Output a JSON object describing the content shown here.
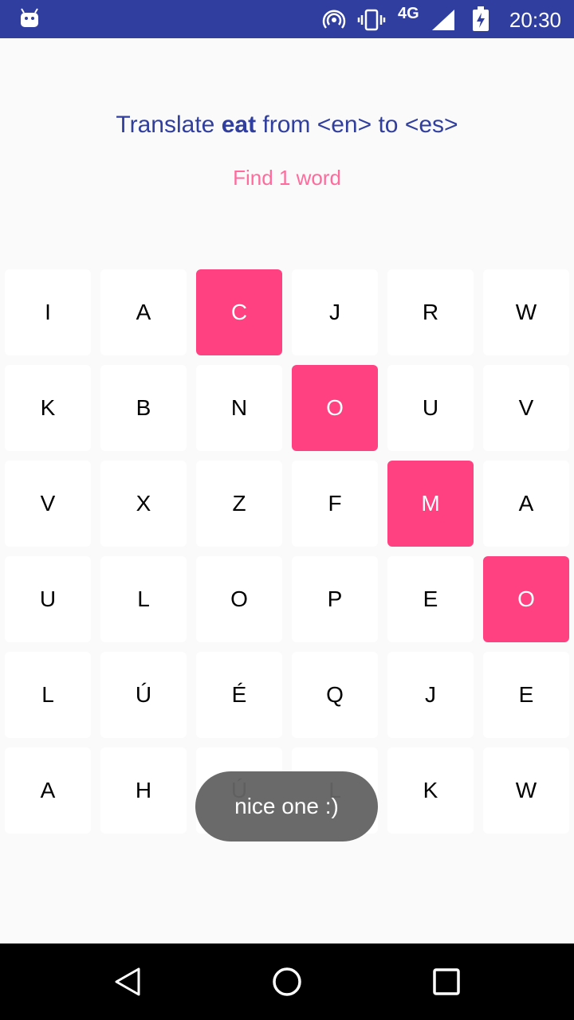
{
  "status_bar": {
    "network": "4G",
    "time": "20:30",
    "icons": [
      "android-icon",
      "hotspot-icon",
      "vibrate-icon",
      "signal-icon",
      "battery-charging-icon"
    ]
  },
  "prompt": {
    "prefix": "Translate ",
    "word": "eat",
    "suffix": " from <en> to <es>",
    "hint": "Find 1 word"
  },
  "colors": {
    "accent": "#ff4081",
    "primary": "#303f9f",
    "hint": "#ff6b9d"
  },
  "grid": {
    "rows": [
      [
        {
          "letter": "I",
          "selected": false
        },
        {
          "letter": "A",
          "selected": false
        },
        {
          "letter": "C",
          "selected": true
        },
        {
          "letter": "J",
          "selected": false
        },
        {
          "letter": "R",
          "selected": false
        },
        {
          "letter": "W",
          "selected": false
        }
      ],
      [
        {
          "letter": "K",
          "selected": false
        },
        {
          "letter": "B",
          "selected": false
        },
        {
          "letter": "N",
          "selected": false
        },
        {
          "letter": "O",
          "selected": true
        },
        {
          "letter": "U",
          "selected": false
        },
        {
          "letter": "V",
          "selected": false
        }
      ],
      [
        {
          "letter": "V",
          "selected": false
        },
        {
          "letter": "X",
          "selected": false
        },
        {
          "letter": "Z",
          "selected": false
        },
        {
          "letter": "F",
          "selected": false
        },
        {
          "letter": "M",
          "selected": true
        },
        {
          "letter": "A",
          "selected": false
        }
      ],
      [
        {
          "letter": "U",
          "selected": false
        },
        {
          "letter": "L",
          "selected": false
        },
        {
          "letter": "O",
          "selected": false
        },
        {
          "letter": "P",
          "selected": false
        },
        {
          "letter": "E",
          "selected": false
        },
        {
          "letter": "O",
          "selected": true
        }
      ],
      [
        {
          "letter": "L",
          "selected": false
        },
        {
          "letter": "Ú",
          "selected": false
        },
        {
          "letter": "É",
          "selected": false
        },
        {
          "letter": "Q",
          "selected": false
        },
        {
          "letter": "J",
          "selected": false
        },
        {
          "letter": "E",
          "selected": false
        }
      ],
      [
        {
          "letter": "A",
          "selected": false
        },
        {
          "letter": "H",
          "selected": false
        },
        {
          "letter": "Ú",
          "selected": false
        },
        {
          "letter": "L",
          "selected": false
        },
        {
          "letter": "K",
          "selected": false
        },
        {
          "letter": "W",
          "selected": false
        }
      ]
    ]
  },
  "toast": {
    "message": "nice one :)"
  },
  "nav_bar": {
    "buttons": [
      "back-icon",
      "home-icon",
      "recents-icon"
    ]
  }
}
